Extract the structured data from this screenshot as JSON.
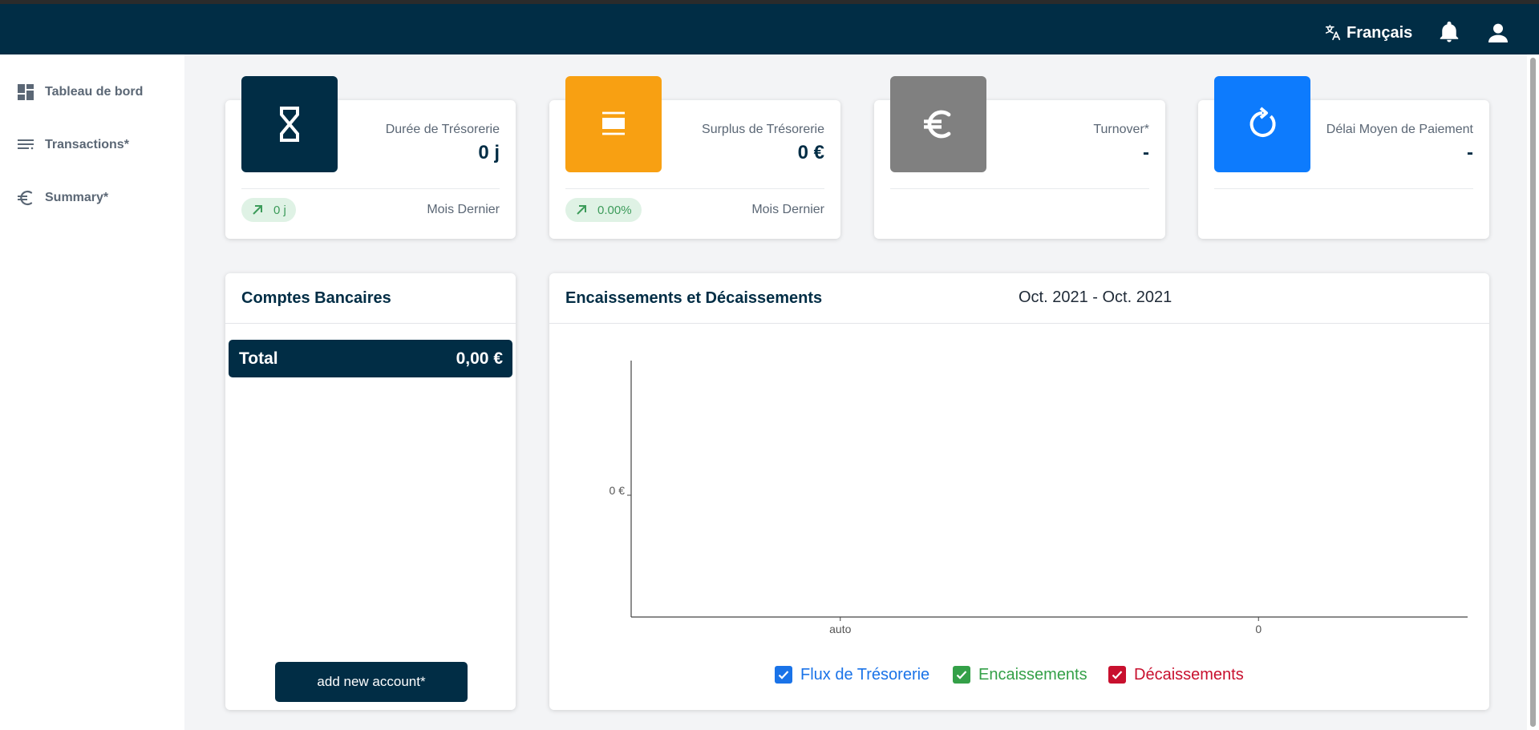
{
  "topbar": {
    "language": "Français"
  },
  "sidebar": {
    "items": [
      {
        "label": "Tableau de bord",
        "icon": "dashboard-icon"
      },
      {
        "label": "Transactions*",
        "icon": "list-icon"
      },
      {
        "label": "Summary*",
        "icon": "euro-icon"
      }
    ]
  },
  "kpis": [
    {
      "title": "Durée de Trésorerie",
      "value": "0 j",
      "icon": "hourglass-icon",
      "color": "#012d45",
      "trend": "0 j",
      "note": "Mois Dernier"
    },
    {
      "title": "Surplus de Trésorerie",
      "value": "0 €",
      "icon": "cash-icon",
      "color": "#f8a012",
      "trend": "0.00%",
      "note": "Mois Dernier"
    },
    {
      "title": "Turnover*",
      "value": "-",
      "icon": "euro-icon",
      "color": "#808080"
    },
    {
      "title": "Délai Moyen de Paiement",
      "value": "-",
      "icon": "refresh-icon",
      "color": "#0d7bfd"
    }
  ],
  "accounts": {
    "title": "Comptes Bancaires",
    "total_label": "Total",
    "total_value": "0,00 €",
    "add_button": "add new account*"
  },
  "cashflow": {
    "title": "Encaissements et Décaissements",
    "period": "Oct. 2021 - Oct. 2021",
    "legend": [
      {
        "label": "Flux de Trésorerie",
        "color": "#1a73e8",
        "checked": true
      },
      {
        "label": "Encaissements",
        "color": "#34a048",
        "checked": true
      },
      {
        "label": "Décaissements",
        "color": "#c8102e",
        "checked": true
      }
    ]
  },
  "chart_data": {
    "type": "bar",
    "categories": [
      "auto",
      "0"
    ],
    "series": [
      {
        "name": "Flux de Trésorerie",
        "values": [
          0,
          0
        ]
      },
      {
        "name": "Encaissements",
        "values": [
          0,
          0
        ]
      },
      {
        "name": "Décaissements",
        "values": [
          0,
          0
        ]
      }
    ],
    "yticks": [
      "0 €"
    ],
    "title": "Encaissements et Décaissements",
    "grid": false,
    "legend_position": "bottom"
  }
}
